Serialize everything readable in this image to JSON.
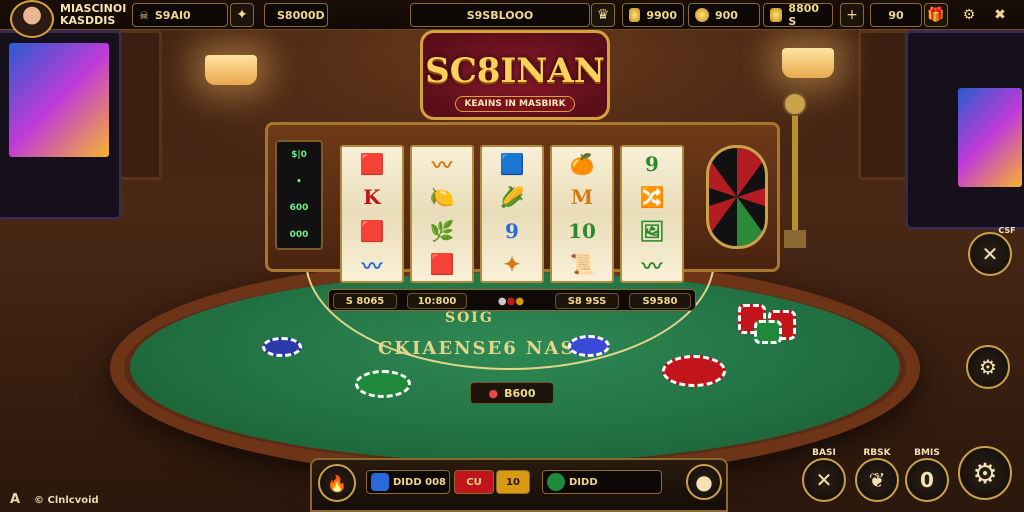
{
  "top_bar": {
    "player_name_line1": "MIASCINOI",
    "player_name_line2": "KASDDIS",
    "balance": "S9AI0",
    "jackpot": "S8000D",
    "center_amount": "S9SBLOOO",
    "gold_amount": "9900",
    "coin_amount": "900",
    "credits_amount": "8800 S",
    "bet_counter": "90"
  },
  "logo": {
    "title": "SC8INAN",
    "subtitle": "KEAINS IN MASBIRK"
  },
  "reels": [
    [
      "🟥",
      "K",
      "🟥",
      "〰"
    ],
    [
      "〰",
      "🍋",
      "🌿",
      "🟥"
    ],
    [
      "🟦",
      "🌽",
      "9",
      "✦"
    ],
    [
      "🍊",
      "M",
      "10",
      "📜"
    ],
    [
      "9",
      "🔀",
      "🖼",
      "〰"
    ]
  ],
  "side_panel": {
    "lines": [
      "$|0",
      "•",
      "600",
      "000"
    ]
  },
  "bet_bar": {
    "left": "S 8065",
    "mid": "10:800",
    "right": "S8 9SS",
    "far_right": "S9580"
  },
  "felt": {
    "top_text": "SOIG",
    "middle_text": "CKIAENSE6 NAS",
    "bet_amount": "B600"
  },
  "side_buttons": {
    "label_top": "CSF",
    "labels": [
      "BASI",
      "RBSK",
      "BMIS"
    ]
  },
  "bottom_panel": {
    "field1": "DIDD 008",
    "field2_btn": "CU",
    "field3": "DIDD",
    "mid_label": "10"
  },
  "footer": {
    "text": "Clnlcvoid"
  }
}
